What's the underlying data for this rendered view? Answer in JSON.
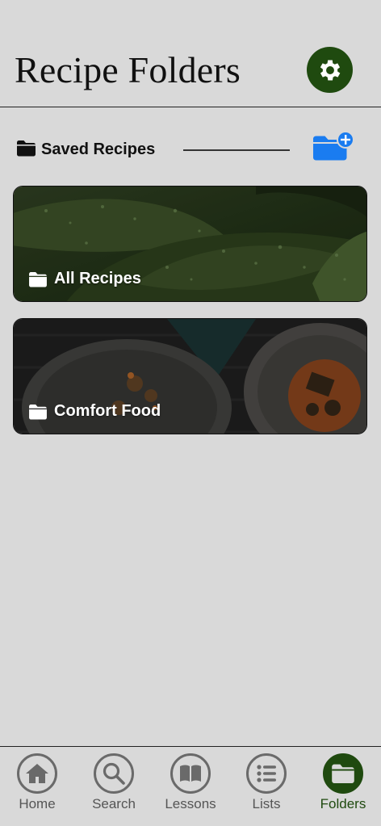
{
  "header": {
    "title": "Recipe Folders",
    "settings_icon": "gear-icon"
  },
  "section": {
    "title": "Saved Recipes",
    "folder_icon": "folder-icon",
    "add_icon": "folder-plus-icon"
  },
  "folders": [
    {
      "label": "All Recipes",
      "icon": "folder-icon"
    },
    {
      "label": "Comfort Food",
      "icon": "folder-icon"
    }
  ],
  "nav": {
    "items": [
      {
        "label": "Home",
        "icon": "home-icon",
        "active": false
      },
      {
        "label": "Search",
        "icon": "search-icon",
        "active": false
      },
      {
        "label": "Lessons",
        "icon": "book-icon",
        "active": false
      },
      {
        "label": "Lists",
        "icon": "list-icon",
        "active": false
      },
      {
        "label": "Folders",
        "icon": "folder-icon",
        "active": true
      }
    ]
  },
  "colors": {
    "background": "#d9d9d9",
    "accent": "#1f4a0f",
    "add_button": "#1a7cf0",
    "nav_inactive": "#6a6a6a"
  }
}
